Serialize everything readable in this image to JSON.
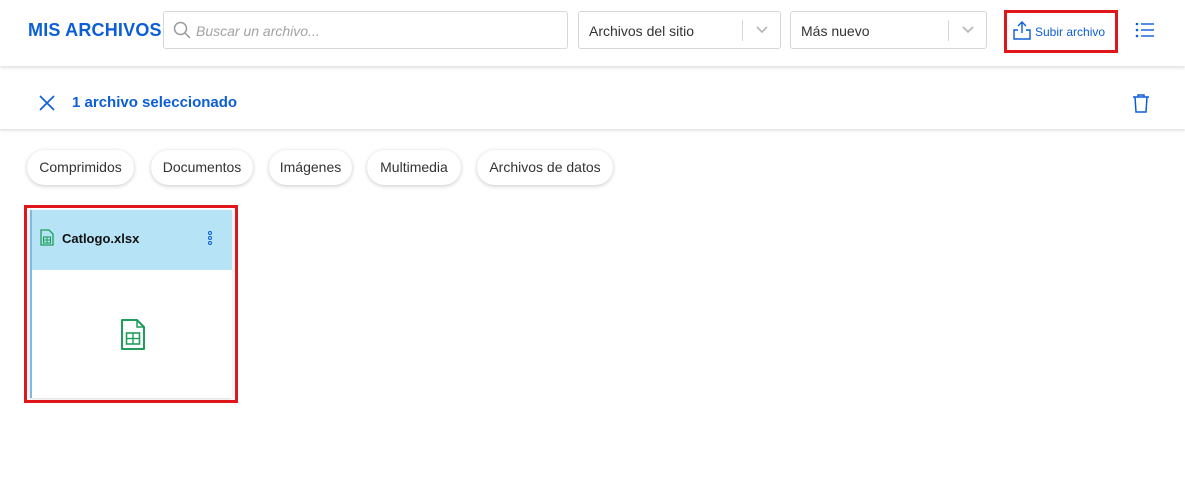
{
  "header": {
    "title": "MIS ARCHIVOS",
    "search_placeholder": "Buscar un archivo...",
    "source_select": "Archivos del sitio",
    "sort_select": "Más nuevo",
    "upload_label": "Subir archivo"
  },
  "selection": {
    "count_label": "1 archivo seleccionado"
  },
  "filters": [
    "Comprimidos",
    "Documentos",
    "Imágenes",
    "Multimedia",
    "Archivos de datos"
  ],
  "files": [
    {
      "name": "Catlogo.xlsx",
      "icon": "spreadsheet-icon"
    }
  ],
  "colors": {
    "accent": "#0b5ed7",
    "highlight_border": "#e0161b",
    "selected_card": "#b6e3f5",
    "spreadsheet": "#1e9e5a"
  }
}
